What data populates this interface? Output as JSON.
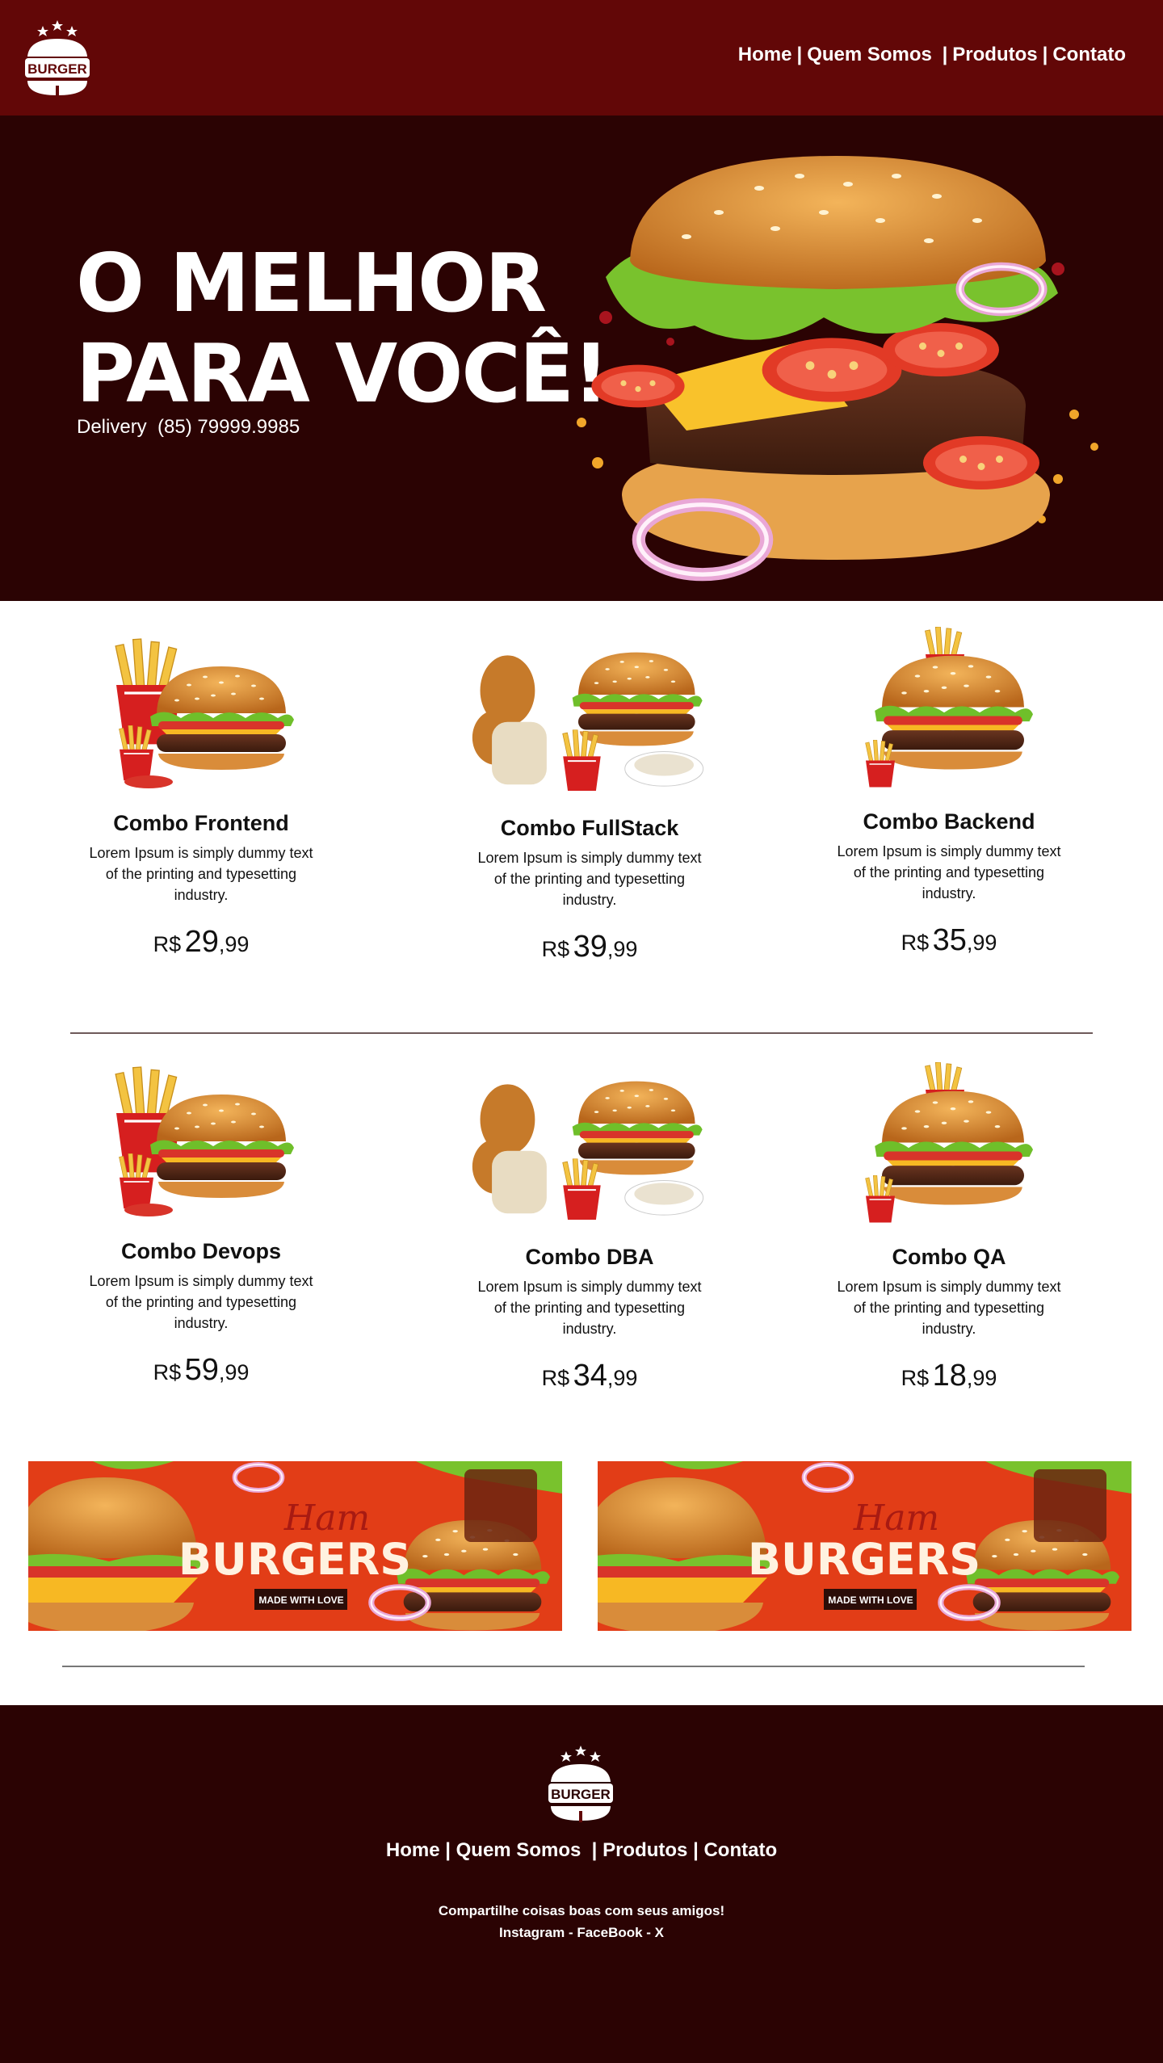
{
  "header": {
    "logo_text": "BURGER",
    "nav": [
      {
        "label": "Home"
      },
      {
        "label": "Quem Somos"
      },
      {
        "label": "Produtos"
      },
      {
        "label": "Contato"
      }
    ]
  },
  "hero": {
    "title_line1": "O MELHOR",
    "title_line2": "PARA VOCÊ!",
    "delivery_label": "Delivery",
    "delivery_phone": "(85) 79999.9985"
  },
  "products": [
    {
      "name": "Combo Frontend",
      "description": "Lorem Ipsum is simply dummy text of the printing and typesetting industry.",
      "currency": "R$",
      "price_int": "29",
      "price_cents": ",99",
      "image": "combo-fries-drink-icon"
    },
    {
      "name": "Combo FullStack",
      "description": "Lorem Ipsum is simply dummy text of the printing and typesetting industry.",
      "currency": "R$",
      "price_int": "39",
      "price_cents": ",99",
      "image": "combo-chicken-fries-icon"
    },
    {
      "name": "Combo Backend",
      "description": "Lorem Ipsum is simply dummy text of the printing and typesetting industry.",
      "currency": "R$",
      "price_int": "35",
      "price_cents": ",99",
      "image": "burger-fries-icon"
    },
    {
      "name": "Combo Devops",
      "description": "Lorem Ipsum is simply dummy text of the printing and typesetting industry.",
      "currency": "R$",
      "price_int": "59",
      "price_cents": ",99",
      "image": "combo-fries-drink-icon"
    },
    {
      "name": "Combo DBA",
      "description": "Lorem Ipsum is simply dummy text of the printing and typesetting industry.",
      "currency": "R$",
      "price_int": "34",
      "price_cents": ",99",
      "image": "combo-chicken-fries-icon"
    },
    {
      "name": "Combo QA",
      "description": "Lorem Ipsum is simply dummy text of the printing and typesetting industry.",
      "currency": "R$",
      "price_int": "18",
      "price_cents": ",99",
      "image": "burger-fries-icon"
    }
  ],
  "banners": [
    {
      "script": "Ham",
      "title": "BURGERS",
      "tagline": "MADE WITH LOVE"
    },
    {
      "script": "Ham",
      "title": "BURGERS",
      "tagline": "MADE WITH LOVE"
    }
  ],
  "footer": {
    "logo_text": "BURGER",
    "nav": [
      {
        "label": "Home"
      },
      {
        "label": "Quem Somos"
      },
      {
        "label": "Produtos"
      },
      {
        "label": "Contato"
      }
    ],
    "share_line1": "Compartilhe coisas boas com seus amigos!",
    "share_line2": "Instagram - FaceBook - X"
  },
  "colors": {
    "header_bg": "#620707",
    "hero_bg": "#2b0303",
    "footer_bg": "#2b0303",
    "banner_bg": "#e23d17",
    "text_light": "#ffffff"
  }
}
